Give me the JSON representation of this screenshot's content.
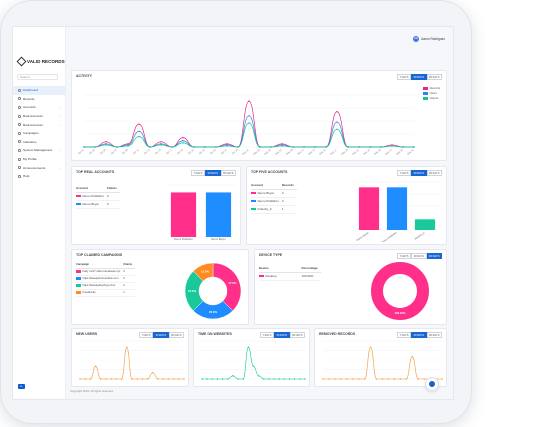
{
  "app": {
    "logo_text": "VALID RECORDS",
    "user_initials": "AR",
    "user_name": "Aaron Rodriguez",
    "footer": "Copyright 2024. All rights reserved."
  },
  "sidebar": {
    "search_placeholder": "Search",
    "items": [
      {
        "label": "Dashboard",
        "active": true
      },
      {
        "label": "Records"
      },
      {
        "label": "Accounts"
      },
      {
        "label": "Real Accounts"
      },
      {
        "label": "Real Accounts"
      },
      {
        "label": "Campaigns"
      },
      {
        "label": "Industries"
      },
      {
        "label": "System Management"
      },
      {
        "label": "My Profile"
      },
      {
        "label": "Announcements"
      },
      {
        "label": "Help"
      }
    ]
  },
  "range_buttons": [
    "7 DAYS",
    "30 DAYS",
    "90 DAYS"
  ],
  "activity": {
    "title": "ACTIVITY",
    "legend": [
      {
        "label": "Records",
        "color": "#e8287f"
      },
      {
        "label": "Users",
        "color": "#2f86e8"
      },
      {
        "label": "Clients",
        "color": "#17c38f"
      }
    ]
  },
  "top_real_accounts": {
    "title": "TOP REAL ACCOUNTS",
    "headers": [
      "Account",
      "Clients"
    ],
    "rows": [
      {
        "name": "Demo Publisher",
        "value": "3",
        "color": "#ff2f8a"
      },
      {
        "name": "Demo Buyer",
        "value": "3",
        "color": "#1f8cff"
      }
    ]
  },
  "top_five_accounts": {
    "title": "TOP FIVE ACCOUNTS",
    "headers": [
      "Account",
      "Records"
    ],
    "rows": [
      {
        "name": "Demo Buyer",
        "value": "4",
        "color": "#ff2f8a"
      },
      {
        "name": "Demo Publisher",
        "value": "4",
        "color": "#1f8cff"
      },
      {
        "name": "Industry_2",
        "value": "1",
        "color": "#19c99a"
      }
    ]
  },
  "top_claimed_campaigns": {
    "title": "TOP CLAIMED CAMPAIGNS",
    "headers": [
      "Campaign",
      "Claims"
    ],
    "rows": [
      {
        "name": "body mc17.client.vtouacess.xyz",
        "value": "3",
        "color": "#ff2f8a"
      },
      {
        "name": "https://beautyforumonline.com",
        "value": "2",
        "color": "#1f8cff"
      },
      {
        "name": "https://beautydaychyq.com/",
        "value": "2",
        "color": "#19c99a"
      },
      {
        "name": "Freelancity",
        "value": "1",
        "color": "#ff8a1f"
      }
    ]
  },
  "device_type": {
    "title": "DEVICE TYPE",
    "headers": [
      "Device",
      "Percentage"
    ],
    "rows": [
      {
        "name": "Desktop",
        "value": "100.00%",
        "color": "#ff2f8a"
      }
    ]
  },
  "new_users": {
    "title": "NEW USERS"
  },
  "time_on_websites": {
    "title": "TIME ON WEBSITES"
  },
  "removed_records": {
    "title": "REMOVED RECORDS"
  },
  "chart_data": [
    {
      "type": "line",
      "title": "ACTIVITY",
      "x": [
        "Apr 01",
        "Apr 03",
        "Apr 05",
        "Apr 07",
        "Apr 09",
        "Apr 11",
        "Apr 13",
        "Apr 15",
        "Apr 17",
        "Apr 19",
        "Apr 21",
        "Apr 23",
        "Apr 25",
        "Apr 27",
        "Apr 29",
        "May 01",
        "May 03",
        "May 05",
        "May 07",
        "May 09",
        "May 11",
        "May 13",
        "May 15",
        "May 17",
        "May 19",
        "May 21",
        "May 23",
        "May 25",
        "May 27",
        "May 29",
        "May 31"
      ],
      "series": [
        {
          "name": "Records",
          "values": [
            0,
            0,
            0.5,
            0,
            0.3,
            2.2,
            0,
            0.5,
            0,
            0.9,
            0,
            0,
            0,
            0.3,
            0,
            4.4,
            0,
            0,
            0.3,
            0,
            0,
            0,
            0,
            3.4,
            0,
            0,
            0,
            0,
            0.2,
            0,
            0
          ]
        },
        {
          "name": "Users",
          "values": [
            0,
            0,
            0.3,
            0,
            0.2,
            1.5,
            0,
            0.3,
            0,
            0.6,
            0,
            0,
            0,
            0.2,
            0,
            3.0,
            0,
            0,
            0.2,
            0,
            0,
            0,
            0,
            2.4,
            0,
            0,
            0,
            0,
            0.1,
            0,
            0
          ]
        },
        {
          "name": "Clients",
          "values": [
            0,
            0,
            0.2,
            0,
            0.1,
            1.0,
            0,
            0.2,
            0,
            0.4,
            0,
            0,
            0,
            0.1,
            0,
            2.3,
            0,
            0,
            0.1,
            0,
            0,
            0,
            0,
            1.7,
            0,
            0,
            0,
            0,
            0.1,
            0,
            0
          ]
        }
      ],
      "ylim": [
        0,
        5
      ]
    },
    {
      "type": "bar",
      "title": "TOP REAL ACCOUNTS",
      "categories": [
        "Demo Publisher",
        "Demo Buyer"
      ],
      "values": [
        3,
        3
      ],
      "ylim": [
        0,
        3.5
      ]
    },
    {
      "type": "bar",
      "title": "TOP FIVE ACCOUNTS",
      "categories": [
        "Demo Buyer",
        "Demo Publisher",
        "Industry_2"
      ],
      "values": [
        4,
        4,
        1
      ],
      "ylim": [
        0,
        4.5
      ]
    },
    {
      "type": "pie",
      "title": "TOP CLAIMED CAMPAIGNS",
      "categories": [
        "body mc17.client.vtouacess.xyz",
        "https://beautyforumonline.com",
        "https://beautydaychyq.com/",
        "Freelancity"
      ],
      "values": [
        37.5,
        25,
        25,
        12.5
      ],
      "labels": [
        "37.5%",
        "25.0%",
        "25.0%",
        "12.5%"
      ]
    },
    {
      "type": "pie",
      "title": "DEVICE TYPE",
      "categories": [
        "Desktop"
      ],
      "values": [
        100
      ],
      "labels": [
        "100.00%"
      ]
    },
    {
      "type": "line",
      "title": "NEW USERS",
      "series": [
        {
          "values": [
            0,
            0,
            0,
            0.4,
            0,
            0,
            0,
            0,
            0,
            1.0,
            0,
            0,
            0,
            0,
            0.2,
            0,
            0,
            0,
            0,
            0,
            0
          ]
        }
      ],
      "ylim": [
        0,
        1.2
      ]
    },
    {
      "type": "line",
      "title": "TIME ON WEBSITES",
      "series": [
        {
          "values": [
            0,
            0,
            0,
            0,
            0,
            0,
            0.1,
            0,
            0,
            1.0,
            0.4,
            0.1,
            0,
            0,
            0,
            0,
            0,
            0,
            0,
            0,
            0
          ]
        }
      ],
      "ylim": [
        0,
        1.2
      ]
    },
    {
      "type": "line",
      "title": "REMOVED RECORDS",
      "series": [
        {
          "values": [
            0,
            0,
            0,
            0,
            0,
            0,
            0,
            0,
            1.0,
            0,
            0,
            0,
            0,
            0,
            0,
            0.7,
            0,
            0,
            0,
            0,
            0
          ]
        }
      ],
      "ylim": [
        0,
        1.2
      ]
    }
  ]
}
